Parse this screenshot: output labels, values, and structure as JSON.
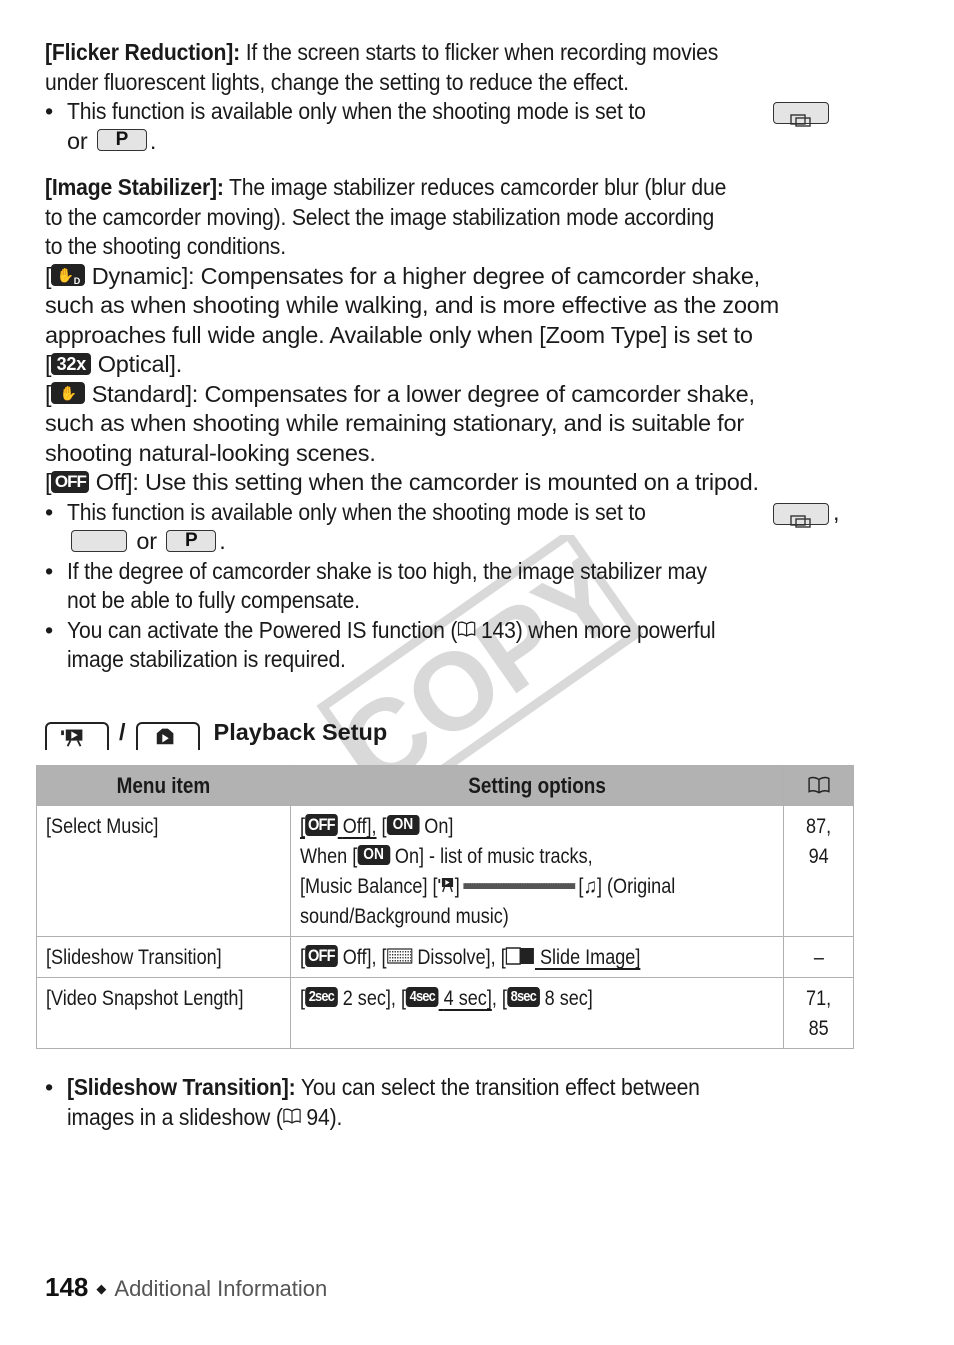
{
  "flicker": {
    "label": "[Flicker Reduction]:",
    "text_line1": " If the screen starts to flicker when recording movies",
    "text_line2": "under fluorescent lights, change the setting to reduce the effect.",
    "bullet_pre": "This function is available only when the shooting mode is set to",
    "bullet_or": "or",
    "bullet_end": "."
  },
  "stabilizer": {
    "label": "[Image Stabilizer]:",
    "text_line1": " The image stabilizer reduces camcorder blur (blur due",
    "text_line2": "to the camcorder moving). Select the image stabilization mode according",
    "text_line3": "to the shooting conditions.",
    "dynamic": {
      "icon_label": "D",
      "line1": "Dynamic]: Compensates for a higher degree of camcorder shake,",
      "line2": "such as when shooting while walking, and is more effective as the zoom",
      "line3": "approaches full wide angle. Available only when [Zoom Type] is set to",
      "zoom_icon": "32x",
      "line4": "Optical]."
    },
    "standard": {
      "line1": "Standard]: Compensates for a lower degree of camcorder shake,",
      "line2": "such as when shooting while remaining stationary, and is suitable for",
      "line3": "shooting natural-looking scenes."
    },
    "off": {
      "icon": "OFF",
      "line1": "Off]: Use this setting when the camcorder is mounted on a tripod."
    },
    "bullets": [
      {
        "pre": "This function is available only when the shooting mode is set to",
        "comma": ",",
        "or": "or",
        "end": "."
      },
      {
        "line1": "If the degree of camcorder shake is too high, the image stabilizer may",
        "line2": "not be able to fully compensate."
      },
      {
        "line1_a": "You can activate the Powered IS function (",
        "line1_ref": "143",
        "line1_b": ") when more powerful",
        "line2": "image stabilization is required."
      }
    ]
  },
  "watermark": "COPY",
  "playback_setup": {
    "separator": "/",
    "title": "Playback Setup",
    "table": {
      "headers": [
        "Menu item",
        "Setting options",
        "book-icon"
      ],
      "rows": [
        {
          "item": "[Select Music]",
          "options": {
            "off_icon": "OFF",
            "off_label": "Off],",
            "on_icon": "ON",
            "on_label": "On]",
            "line2_pre": "When [",
            "line2_post": "On] - list of music tracks,",
            "line3_pre": "[Music Balance] [",
            "line3_mid": "]",
            "line3_post": "] (Original",
            "line4": "sound/Background music)"
          },
          "ref": [
            "87,",
            "94"
          ]
        },
        {
          "item": "[Slideshow Transition]",
          "options": {
            "off_icon": "OFF",
            "off_label": "Off], [",
            "dissolve": "Dissolve], [",
            "slide": "Slide Image]"
          },
          "ref": [
            "–"
          ]
        },
        {
          "item": "[Video Snapshot Length]",
          "options": {
            "s2_icon": "2sec",
            "s2": "2 sec], [",
            "s4_icon": "4sec",
            "s4": "4 sec]",
            "sep": ", [",
            "s8_icon": "8sec",
            "s8": "8 sec]"
          },
          "ref": [
            "71,",
            "85"
          ]
        }
      ]
    },
    "note": {
      "label": "[Slideshow Transition]:",
      "text_line1": " You can select the transition effect between",
      "text_line2_a": "images in a slideshow (",
      "text_line2_ref": "94",
      "text_line2_b": ")."
    }
  },
  "footer": {
    "page_number": "148",
    "separator": "◆",
    "section": "Additional Information"
  }
}
